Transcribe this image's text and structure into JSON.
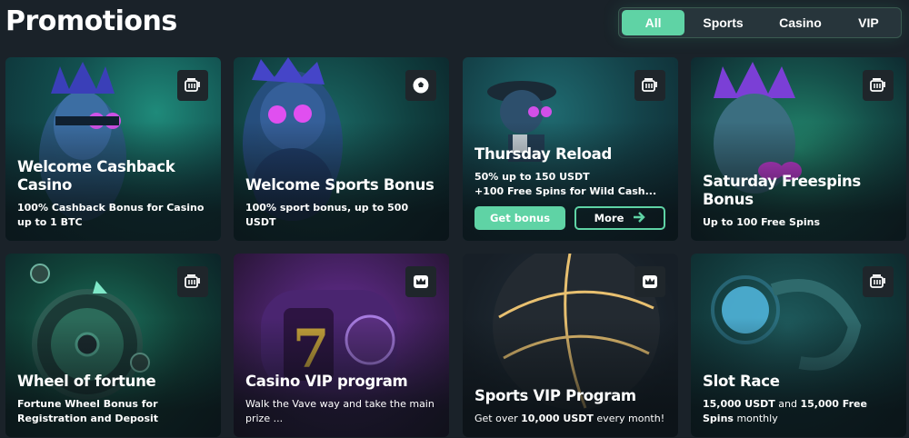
{
  "header": {
    "title": "Promotions"
  },
  "filters": [
    {
      "label": "All",
      "active": true
    },
    {
      "label": "Sports",
      "active": false
    },
    {
      "label": "Casino",
      "active": false
    },
    {
      "label": "VIP",
      "active": false
    }
  ],
  "colors": {
    "accent": "#5fd3a5",
    "background": "#1a2229",
    "badge": "#1f262b"
  },
  "cards": [
    {
      "title": "Welcome Cashback Casino",
      "desc": "100% Cashback Bonus for Casino up to 1 BTC",
      "icon": "slot-icon"
    },
    {
      "title": "Welcome Sports Bonus",
      "desc": "100% sport bonus, up to 500 USDT",
      "icon": "soccer-ball-icon"
    },
    {
      "title": "Thursday Reload",
      "desc_lines": [
        "50% up to 150 USDT",
        "+100 Free Spins for Wild Cash..."
      ],
      "icon": "slot-icon",
      "buttons": {
        "primary": "Get bonus",
        "secondary": "More"
      }
    },
    {
      "title": "Saturday Freespins Bonus",
      "desc": "Up to 100 Free Spins",
      "icon": "slot-icon"
    },
    {
      "title": "Wheel of fortune",
      "desc": "Fortune Wheel Bonus for Registration and Deposit",
      "icon": "slot-icon"
    },
    {
      "title": "Casino VIP program",
      "desc": "Walk the Vave way and take the main prize ...",
      "icon": "crown-icon"
    },
    {
      "title": "Sports VIP Program",
      "desc_parts": [
        "Get over ",
        "10,000 USDT",
        " every month!"
      ],
      "icon": "crown-icon"
    },
    {
      "title": "Slot Race",
      "desc_parts": [
        "15,000 USDT",
        " and ",
        "15,000 Free Spins",
        " monthly"
      ],
      "icon": "slot-icon"
    }
  ]
}
